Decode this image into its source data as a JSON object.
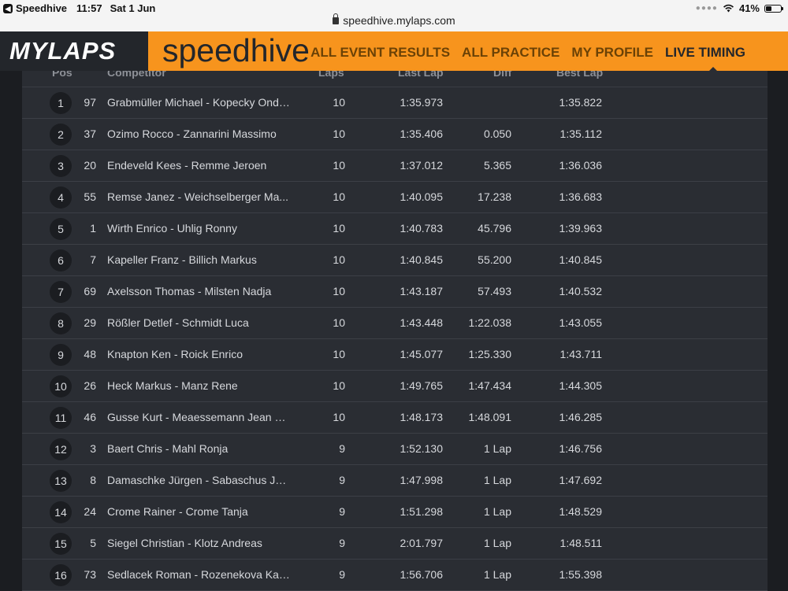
{
  "status_bar": {
    "app": "Speedhive",
    "time": "11:57",
    "date": "Sat 1 Jun",
    "battery": "41%",
    "battery_level": 0.41
  },
  "url": "speedhive.mylaps.com",
  "header": {
    "brand": "MYLAPS",
    "product": "speedhive",
    "nav": [
      "ALL EVENT RESULTS",
      "ALL PRACTICE",
      "MY PROFILE",
      "LIVE TIMING"
    ],
    "active_nav": "LIVE TIMING",
    "accent": "#f7941d"
  },
  "table": {
    "columns": {
      "pos": "Pos",
      "competitor": "Competitor",
      "laps": "Laps",
      "last_lap": "Last Lap",
      "diff": "Diff",
      "best_lap": "Best Lap"
    },
    "rows": [
      {
        "pos": "1",
        "num": "97",
        "competitor": "Grabmüller Michael - Kopecky Ondrej",
        "laps": "10",
        "last": "1:35.973",
        "diff": "",
        "best": "1:35.822"
      },
      {
        "pos": "2",
        "num": "37",
        "competitor": "Ozimo Rocco - Zannarini Massimo",
        "laps": "10",
        "last": "1:35.406",
        "diff": "0.050",
        "best": "1:35.112"
      },
      {
        "pos": "3",
        "num": "20",
        "competitor": "Endeveld Kees - Remme Jeroen",
        "laps": "10",
        "last": "1:37.012",
        "diff": "5.365",
        "best": "1:36.036"
      },
      {
        "pos": "4",
        "num": "55",
        "competitor": "Remse Janez - Weichselberger Ma...",
        "laps": "10",
        "last": "1:40.095",
        "diff": "17.238",
        "best": "1:36.683"
      },
      {
        "pos": "5",
        "num": "1",
        "competitor": "Wirth Enrico - Uhlig Ronny",
        "laps": "10",
        "last": "1:40.783",
        "diff": "45.796",
        "best": "1:39.963"
      },
      {
        "pos": "6",
        "num": "7",
        "competitor": "Kapeller Franz - Billich Markus",
        "laps": "10",
        "last": "1:40.845",
        "diff": "55.200",
        "best": "1:40.845"
      },
      {
        "pos": "7",
        "num": "69",
        "competitor": "Axelsson Thomas - Milsten Nadja",
        "laps": "10",
        "last": "1:43.187",
        "diff": "57.493",
        "best": "1:40.532"
      },
      {
        "pos": "8",
        "num": "29",
        "competitor": "Rößler Detlef - Schmidt Luca",
        "laps": "10",
        "last": "1:43.448",
        "diff": "1:22.038",
        "best": "1:43.055"
      },
      {
        "pos": "9",
        "num": "48",
        "competitor": "Knapton Ken - Roick Enrico",
        "laps": "10",
        "last": "1:45.077",
        "diff": "1:25.330",
        "best": "1:43.711"
      },
      {
        "pos": "10",
        "num": "26",
        "competitor": "Heck Markus - Manz Rene",
        "laps": "10",
        "last": "1:49.765",
        "diff": "1:47.434",
        "best": "1:44.305"
      },
      {
        "pos": "11",
        "num": "46",
        "competitor": "Gusse Kurt - Meaessemann Jean Pi...",
        "laps": "10",
        "last": "1:48.173",
        "diff": "1:48.091",
        "best": "1:46.285"
      },
      {
        "pos": "12",
        "num": "3",
        "competitor": "Baert Chris - Mahl Ronja",
        "laps": "9",
        "last": "1:52.130",
        "diff": "1 Lap",
        "best": "1:46.756"
      },
      {
        "pos": "13",
        "num": "8",
        "competitor": "Damaschke Jürgen - Sabaschus Jü...",
        "laps": "9",
        "last": "1:47.998",
        "diff": "1 Lap",
        "best": "1:47.692"
      },
      {
        "pos": "14",
        "num": "24",
        "competitor": "Crome Rainer - Crome Tanja",
        "laps": "9",
        "last": "1:51.298",
        "diff": "1 Lap",
        "best": "1:48.529"
      },
      {
        "pos": "15",
        "num": "5",
        "competitor": "Siegel Christian - Klotz Andreas",
        "laps": "9",
        "last": "2:01.797",
        "diff": "1 Lap",
        "best": "1:48.511"
      },
      {
        "pos": "16",
        "num": "73",
        "competitor": "Sedlacek Roman - Rozenekova Kat...",
        "laps": "9",
        "last": "1:56.706",
        "diff": "1 Lap",
        "best": "1:55.398"
      }
    ]
  }
}
